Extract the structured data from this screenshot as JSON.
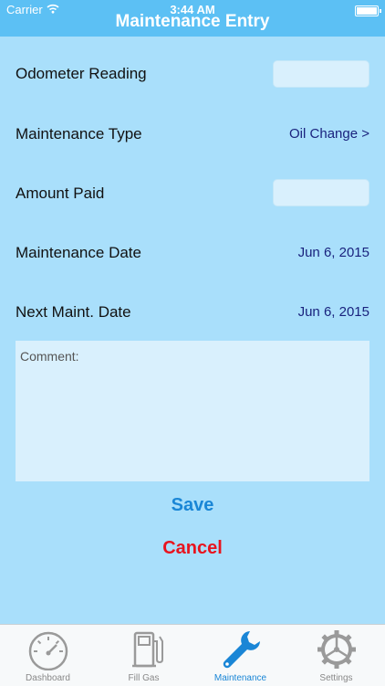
{
  "status": {
    "carrier": "Carrier",
    "time": "3:44 AM"
  },
  "header": {
    "title": "Maintenance Entry"
  },
  "form": {
    "odometer_label": "Odometer Reading",
    "odometer_value": "",
    "type_label": "Maintenance Type",
    "type_value": "Oil Change >",
    "amount_label": "Amount Paid",
    "amount_value": "",
    "date_label": "Maintenance Date",
    "date_value": "Jun 6, 2015",
    "next_label": "Next Maint. Date",
    "next_value": "Jun 6, 2015",
    "comment_label": "Comment:"
  },
  "actions": {
    "save": "Save",
    "cancel": "Cancel"
  },
  "colors": {
    "save": "#1a86d6",
    "cancel": "#e8141e",
    "accent": "#5cc0f4"
  },
  "tabs": [
    {
      "label": "Dashboard",
      "icon": "speedometer-icon",
      "active": false
    },
    {
      "label": "Fill Gas",
      "icon": "gas-pump-icon",
      "active": false
    },
    {
      "label": "Maintenance",
      "icon": "wrench-icon",
      "active": true
    },
    {
      "label": "Settings",
      "icon": "gear-icon",
      "active": false
    }
  ]
}
